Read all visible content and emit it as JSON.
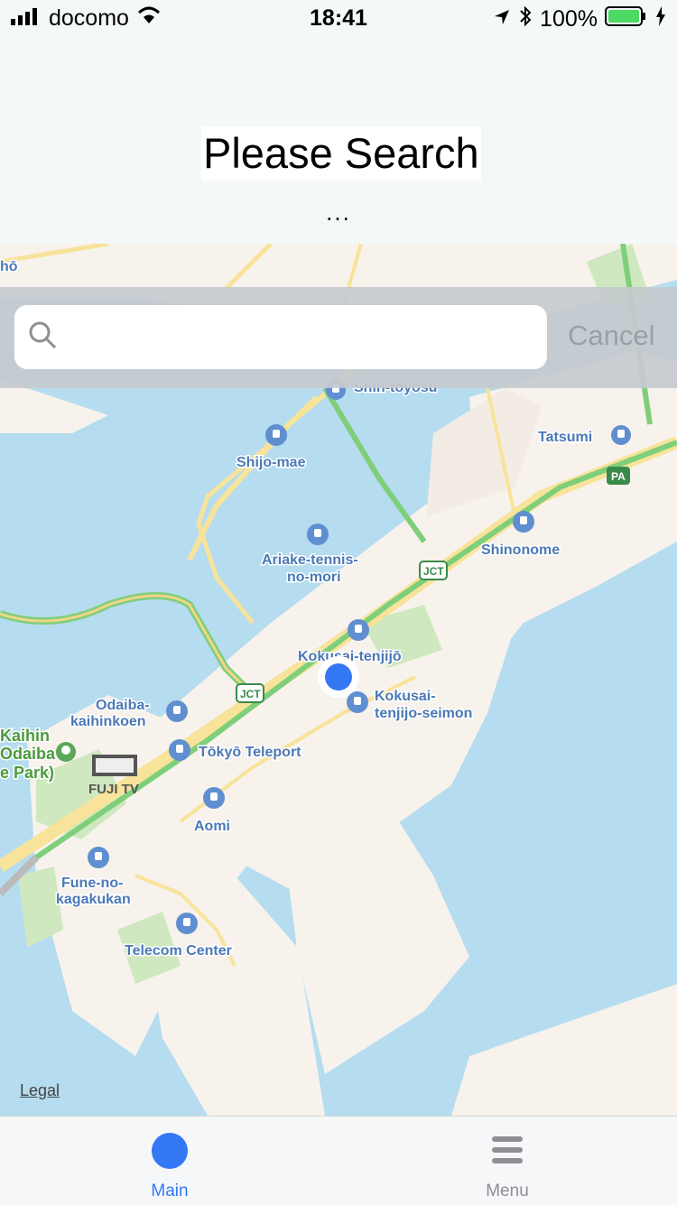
{
  "status_bar": {
    "carrier": "docomo",
    "time": "18:41",
    "battery": "100%"
  },
  "header": {
    "title": "Please Search",
    "subtitle": "..."
  },
  "search": {
    "placeholder": "",
    "cancel_label": "Cancel"
  },
  "map": {
    "labels": {
      "shijo_mae": "Shijo-mae",
      "ariake_1": "Ariake-tennis-",
      "ariake_2": "no-mori",
      "tatsumi": "Tatsumi",
      "shinonome": "Shinonome",
      "kokusai_tenjijo": "Kokusai-tenjijō",
      "kokusai_seimon_1": "Kokusai-",
      "kokusai_seimon_2": "tenjijo-seimon",
      "odaiba_1": "Odaiba-",
      "odaiba_2": "kaihinkoen",
      "tokyo_teleport": "Tōkyō Teleport",
      "fuji_tv": "FUJI TV",
      "kaihin_1": "Kaihin",
      "kaihin_2": "Odaiba",
      "kaihin_3": "e Park)",
      "aomi": "Aomi",
      "fune_1": "Fune-no-",
      "fune_2": "kagakukan",
      "telecom": "Telecom Center",
      "shin_toyosu": "Shin-toyosu",
      "jct": "JCT",
      "pa": "PA",
      "cut_label": "hō"
    },
    "legal": "Legal",
    "colors": {
      "water": "#b5dcef",
      "land": "#f7f2ec",
      "park": "#cfe8bf",
      "road": "#f8e39a",
      "highway": "#7fcf7a",
      "poi": "#5f8fd0",
      "user": "#3478f6"
    }
  },
  "tabbar": {
    "tabs": [
      {
        "label": "Main",
        "icon": "circle-icon",
        "active": true
      },
      {
        "label": "Menu",
        "icon": "hamburger-icon",
        "active": false
      }
    ],
    "active_color": "#3478f6",
    "inactive_color": "#8e8e93"
  }
}
